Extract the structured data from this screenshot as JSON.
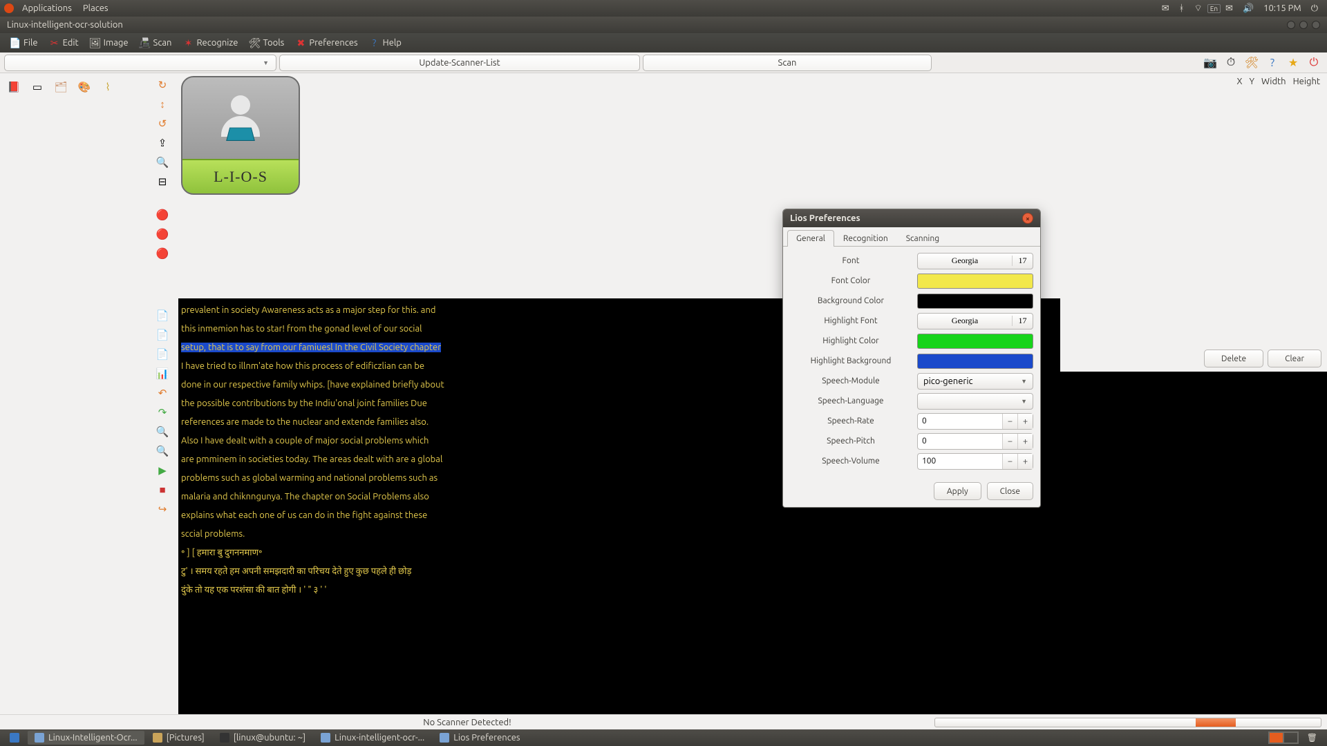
{
  "panel": {
    "applications": "Applications",
    "places": "Places",
    "keyboard": "En",
    "time": "10:15 PM"
  },
  "window": {
    "title": "Linux-intelligent-ocr-solution"
  },
  "menubar": {
    "file": "File",
    "edit": "Edit",
    "image": "Image",
    "scan": "Scan",
    "recognize": "Recognize",
    "tools": "Tools",
    "preferences": "Preferences",
    "help": "Help"
  },
  "toolbar": {
    "update_scanner_list": "Update-Scanner-List",
    "scan": "Scan"
  },
  "thumb_label": "L-I-O-S",
  "coords": {
    "x": "X",
    "y": "Y",
    "w": "Width",
    "h": "Height"
  },
  "buttons": {
    "delete": "Delete",
    "clear": "Clear"
  },
  "status": "No Scanner Detected!",
  "text_lines": [
    "prevalent in society Awareness acts as a major step for this. and",
    "this inmemion has to star! from the gonad level of our social",
    "setup, that is to say from our famiuesl In the Civil Society chapter",
    "I have tried to illnm'ate how this process of edificzlian can be",
    "done in our respective family whips. [have explained briefly about",
    "the possible contributions by the Indiu'onal joint families Due",
    "references are made to the nuclear and extende families also.",
    "Also I have dealt with a couple of major social problems which",
    "are pmminem in societies today. The areas dealt with are a global",
    "problems such as global warming and national problems such as",
    "malaria and chiknngunya. The chapter on Social Problems also",
    "explains what each one of us can do in the fight against these",
    "sccial problems.",
    "",
    "॰ ] [ हमारा बु दुगननमाण॰",
    "",
    "टु'  । समय रहते हम अपनी समझदारी का परिचय देते हुए कुछ पहले ही छोड़",
    "दुंके तो यह एक परशंसा की बात होगी । ' \" ३ ' '"
  ],
  "dialog": {
    "title": "Lios Preferences",
    "tabs": {
      "general": "General",
      "recognition": "Recognition",
      "scanning": "Scanning"
    },
    "labels": {
      "font": "Font",
      "font_color": "Font Color",
      "bg_color": "Background Color",
      "hl_font": "Highlight Font",
      "hl_color": "Highlight Color",
      "hl_bg": "Highlight Background",
      "speech_module": "Speech-Module",
      "speech_lang": "Speech-Language",
      "speech_rate": "Speech-Rate",
      "speech_pitch": "Speech-Pitch",
      "speech_volume": "Speech-Volume"
    },
    "values": {
      "font_name": "Georgia",
      "font_size": "17",
      "hl_font_name": "Georgia",
      "hl_font_size": "17",
      "speech_module": "pico-generic",
      "speech_lang": "",
      "speech_rate": "0",
      "speech_pitch": "0",
      "speech_volume": "100"
    },
    "colors": {
      "font_color": "#f2e84b",
      "bg_color": "#000000",
      "hl_color": "#17d41a",
      "hl_bg": "#1b4acb"
    },
    "actions": {
      "apply": "Apply",
      "close": "Close"
    }
  },
  "taskbar": {
    "items": [
      "Linux-Intelligent-Ocr...",
      "[Pictures]",
      "[linux@ubuntu: ~]",
      "Linux-intelligent-ocr-...",
      "Lios Preferences"
    ]
  }
}
